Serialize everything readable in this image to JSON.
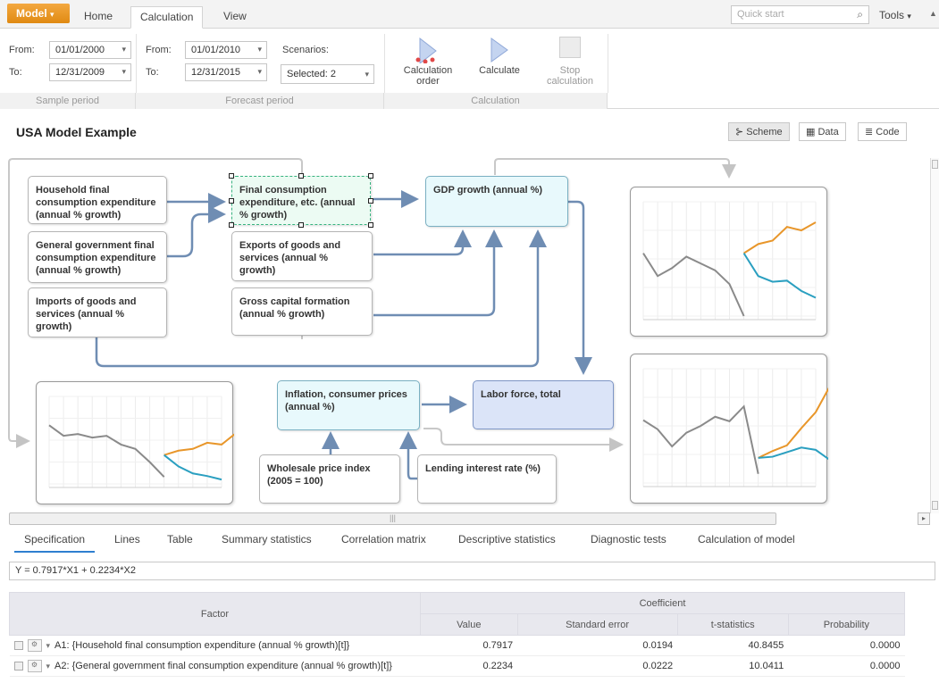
{
  "tabbar": {
    "model_label": "Model",
    "tabs": [
      "Home",
      "Calculation",
      "View"
    ],
    "quick_start_placeholder": "Quick start",
    "tools_label": "Tools"
  },
  "ribbon": {
    "sample": {
      "from_label": "From:",
      "from_value": "01/01/2000",
      "to_label": "To:",
      "to_value": "12/31/2009",
      "footer": "Sample period"
    },
    "forecast": {
      "from_label": "From:",
      "from_value": "01/01/2010",
      "to_label": "To:",
      "to_value": "12/31/2015",
      "footer": "Forecast period"
    },
    "scenarios": {
      "label": "Scenarios:",
      "value": "Selected: 2"
    },
    "calculation": {
      "order_label_1": "Calculation",
      "order_label_2": "order",
      "calculate_label": "Calculate",
      "stop_label_1": "Stop",
      "stop_label_2": "calculation",
      "footer": "Calculation"
    }
  },
  "page": {
    "title": "USA Model Example",
    "views": [
      "Scheme",
      "Data",
      "Code"
    ]
  },
  "nodes": {
    "household": "Household final consumption expenditure (annual % growth)",
    "government": "General government final consumption expenditure (annual % growth)",
    "imports": "Imports of goods and services (annual % growth)",
    "final_consumption": "Final consumption expenditure, etc. (annual % growth)",
    "exports": "Exports of goods and services (annual % growth)",
    "capital": "Gross capital formation (annual % growth)",
    "gdp": "GDP growth (annual %)",
    "inflation": "Inflation, consumer prices (annual %)",
    "labor": "Labor force, total",
    "wholesale": "Wholesale price index (2005 = 100)",
    "lending": "Lending interest rate (%)"
  },
  "colors": {
    "history": "#8a8a8a",
    "scenario1": "#e8962a",
    "scenario2": "#2a9fc0",
    "arrow": "#6f8db3"
  },
  "chart_data": [
    {
      "type": "line",
      "series": [
        {
          "values": [
            0.55,
            0.35,
            0.42,
            0.52,
            0.46,
            0.4,
            0.28,
            0.0
          ]
        },
        {
          "values": [
            0.55,
            0.63,
            0.66,
            0.78,
            0.75,
            0.82
          ]
        },
        {
          "values": [
            0.55,
            0.35,
            0.3,
            0.31,
            0.22,
            0.16
          ]
        }
      ]
    },
    {
      "type": "line",
      "series": [
        {
          "values": [
            0.67,
            0.55,
            0.57,
            0.53,
            0.55,
            0.45,
            0.4,
            0.25,
            0.08
          ]
        },
        {
          "values": [
            0.33,
            0.38,
            0.4,
            0.47,
            0.45,
            0.58
          ]
        },
        {
          "values": [
            0.33,
            0.2,
            0.12,
            0.09,
            0.05
          ]
        }
      ]
    },
    {
      "type": "line",
      "series": [
        {
          "values": [
            0.55,
            0.47,
            0.32,
            0.44,
            0.5,
            0.58,
            0.54,
            0.67,
            0.08
          ]
        },
        {
          "values": [
            0.22,
            0.28,
            0.33,
            0.48,
            0.62,
            0.85
          ]
        },
        {
          "values": [
            0.22,
            0.23,
            0.27,
            0.31,
            0.29,
            0.2
          ]
        }
      ]
    }
  ],
  "bottom_tabs": [
    "Specification",
    "Lines",
    "Table",
    "Summary statistics",
    "Correlation matrix",
    "Descriptive statistics",
    "Diagnostic tests",
    "Calculation of model"
  ],
  "formula": "Y = 0.7917*X1 + 0.2234*X2",
  "table": {
    "factor_header": "Factor",
    "coef_header": "Coefficient",
    "columns": [
      "Value",
      "Standard error",
      "t-statistics",
      "Probability"
    ],
    "rows": [
      {
        "factor": "A1: {Household final consumption expenditure (annual % growth)[t]}",
        "value": "0.7917",
        "se": "0.0194",
        "t": "40.8455",
        "p": "0.0000"
      },
      {
        "factor": "A2: {General government final consumption expenditure (annual % growth)[t]}",
        "value": "0.2234",
        "se": "0.0222",
        "t": "10.0411",
        "p": "0.0000"
      }
    ]
  }
}
